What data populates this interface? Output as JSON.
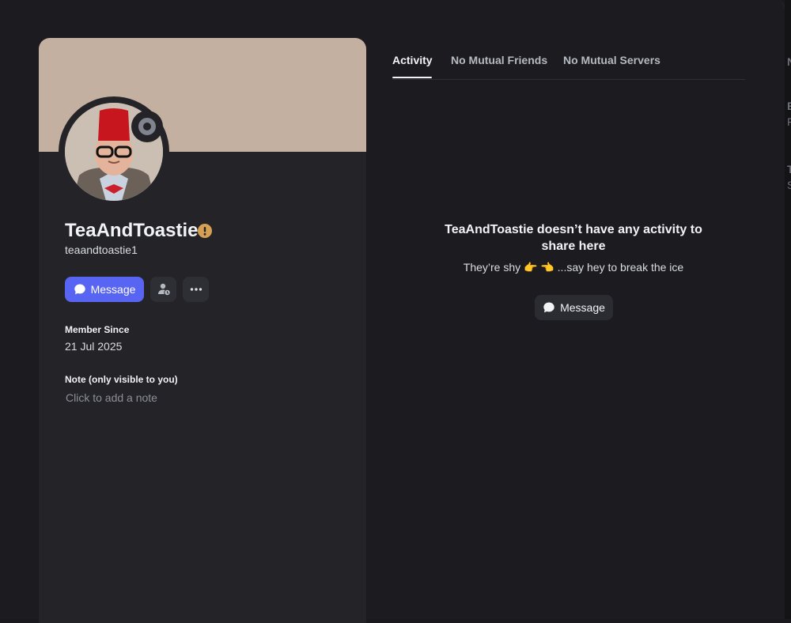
{
  "profile": {
    "display_name": "TeaAndToastie",
    "username": "teaandtoastie1",
    "status": "offline",
    "banner_color": "#c4b0a1",
    "message_button": "Message",
    "member_since_label": "Member Since",
    "member_since_value": "21 Jul 2025",
    "note_label": "Note (only visible to you)",
    "note_placeholder": "Click to add a note"
  },
  "tabs": [
    {
      "label": "Activity",
      "active": true
    },
    {
      "label": "No Mutual Friends",
      "active": false
    },
    {
      "label": "No Mutual Servers",
      "active": false
    }
  ],
  "activity": {
    "empty_title": "TeaAndToastie doesn’t have any activity to share here",
    "empty_subtitle": "They’re shy 👉 👈 ...say hey to break the ice",
    "message_button": "Message"
  },
  "icons": {
    "chat": "chat-bubble-icon",
    "friend_pending": "add-friend-pending-icon",
    "more": "more-horizontal-icon",
    "warning": "warning-icon"
  },
  "colors": {
    "accent": "#5865f2",
    "warning": "#d6a054",
    "offline": "#80848e"
  },
  "side_peek_letters": [
    "N",
    "E",
    "F",
    "T",
    "S"
  ]
}
